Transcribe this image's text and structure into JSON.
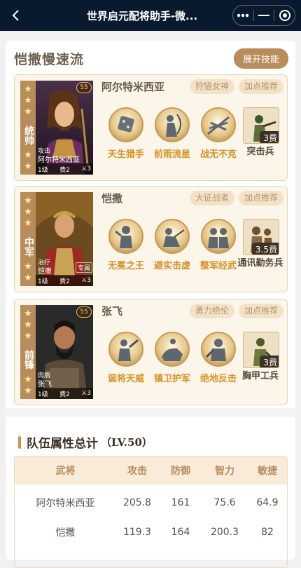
{
  "titlebar": {
    "title": "世界启元配将助手-微..."
  },
  "lineup": {
    "title": "恺撒慢速流",
    "expand_label": "展开技能"
  },
  "cards": [
    {
      "position": "统帅",
      "general": "阿尔特米西亚",
      "portrait": {
        "level_badge": "55",
        "troop": "攻击",
        "name": "阿尔特米西亚",
        "level": "1级",
        "cost": "费2",
        "count": "3",
        "special": ""
      },
      "tags": [
        "狩猎女神",
        "加点推荐"
      ],
      "skills": [
        "天生猎手",
        "前雨流星",
        "战无不克"
      ],
      "unit": {
        "name": "突击兵",
        "cost": "3费"
      }
    },
    {
      "position": "中军",
      "general": "恺撒",
      "portrait": {
        "level_badge": "",
        "troop": "治疗",
        "name": "恺撒",
        "level": "1级",
        "cost": "费2",
        "count": "3",
        "special": "专属"
      },
      "tags": [
        "大征战者",
        "加点推荐"
      ],
      "skills": [
        "无冕之王",
        "避实击虚",
        "整军经武"
      ],
      "unit": {
        "name": "通讯勤务兵",
        "cost": "3.5费"
      }
    },
    {
      "position": "前锋",
      "general": "张飞",
      "portrait": {
        "level_badge": "55",
        "troop": "肉盾",
        "name": "张飞",
        "level": "1级",
        "cost": "费2",
        "count": "3",
        "special": ""
      },
      "tags": [
        "勇力绝伦",
        "加点推荐"
      ],
      "skills": [
        "诞将天威",
        "镇卫护军",
        "绝地反击"
      ],
      "unit": {
        "name": "胸甲工兵",
        "cost": "3费"
      }
    }
  ],
  "stats": {
    "title": "队伍属性总计",
    "level": "（LV.50）",
    "headers": [
      "武将",
      "攻击",
      "防御",
      "智力",
      "敏捷"
    ],
    "rows": [
      [
        "阿尔特米西亚",
        "205.8",
        "161",
        "75.6",
        "64.9"
      ],
      [
        "恺撒",
        "119.3",
        "164",
        "200.3",
        "82"
      ],
      [
        "",
        "",
        "",
        "",
        ""
      ]
    ]
  },
  "colors": {
    "accent": "#b98c5c",
    "skill_text": "#d69224",
    "titlebar": "#0a1a2e"
  }
}
